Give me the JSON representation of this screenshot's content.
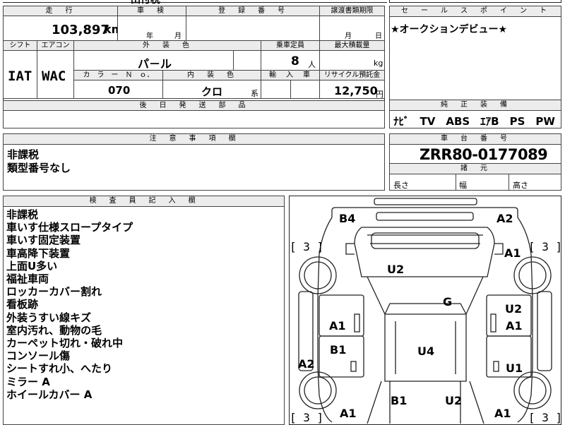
{
  "top_partial": "田付税",
  "mileage": {
    "label": "走　行",
    "value": "103,897",
    "unit": "km"
  },
  "shaken": {
    "label": "車　検",
    "year": "年",
    "month": "月"
  },
  "registration": {
    "label": "登　録　番　号",
    "value": ""
  },
  "transfer": {
    "label": "譲渡書類期限",
    "month": "月",
    "day": "日"
  },
  "shift": {
    "label": "シフト",
    "value": "IAT"
  },
  "aircon": {
    "label": "エアコン",
    "value": "WAC"
  },
  "exterior": {
    "label": "外　装　色",
    "value": "パ－ル"
  },
  "capacity": {
    "label": "乗車定員",
    "value": "8",
    "unit": "人"
  },
  "max_load": {
    "label": "最大積載量",
    "unit": "kg"
  },
  "color_no": {
    "label": "カ　ラ　ー　Ｎ　ｏ．",
    "value": "070"
  },
  "interior": {
    "label": "内　装　色",
    "value": "クロ",
    "suffix": "系"
  },
  "import": {
    "label": "輸　入　車"
  },
  "recycle": {
    "label": "リサイクル預託金",
    "value": "12,750",
    "unit": "円"
  },
  "later_parts": {
    "label": "後　日　発　送　部　品"
  },
  "sales_point": {
    "label": "セ　ー　ル　ス　ポ　イ　ン　ト",
    "text": "★オークションデビュー★"
  },
  "equipment": {
    "label": "純　正　装　備",
    "text": "ﾅﾋﾞ　TV　ABS　ｴｱB　PS　PW"
  },
  "caution": {
    "label": "注　意　事　項　欄",
    "lines": [
      "非課税",
      "類型番号なし"
    ]
  },
  "chassis": {
    "label": "車　台　番　号",
    "value": "ZRR80-0177089"
  },
  "dims": {
    "label": "諸　元",
    "length": "長さ",
    "width": "幅",
    "height": "高さ"
  },
  "inspector": {
    "label": "検　査　員　記　入　欄",
    "lines": [
      "非課税",
      "車いす仕様スロープタイプ",
      "車いす固定装置",
      "車高降下装置",
      "上面U多い",
      "福祉車両",
      "ロッカーカバー割れ",
      "看板跡",
      "外装うすい線キズ",
      "室内汚れ、動物の毛",
      "カーペット切れ・破れ中",
      "コンソール傷",
      "シートすれ小、へたり",
      "ミラー A",
      "ホイールカバー A"
    ]
  },
  "diagram": {
    "marks": {
      "b4": "B4",
      "a2_top": "A2",
      "a1_rf": "A1",
      "u2_hood": "U2",
      "g": "G",
      "u2_rd": "U2",
      "a1_rd": "A1",
      "a1_ld": "A1",
      "b1_ld": "B1",
      "a2_l": "A2",
      "u4": "U4",
      "u1_r": "U1",
      "a1_lr": "A1",
      "b1_b": "B1",
      "u2_b": "U2",
      "a1_rr": "A1"
    },
    "tires": {
      "fl": "[ 3 ]",
      "fr": "[ 3 ]",
      "rl": "[ 3 ]",
      "rr": "[ 3 ]"
    }
  }
}
